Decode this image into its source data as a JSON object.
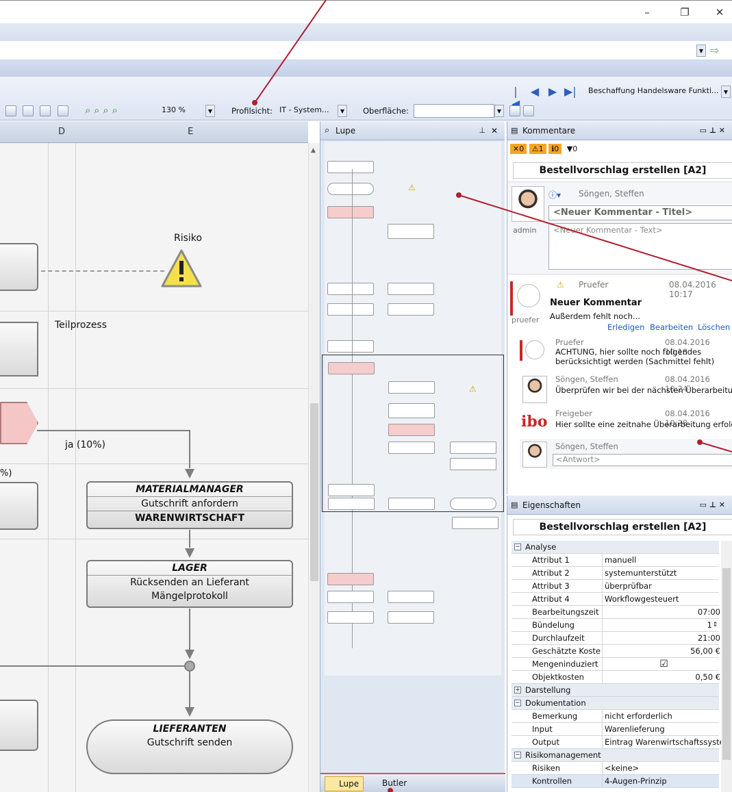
{
  "window": {
    "minimize": "–",
    "restore": "❐",
    "close": "✕"
  },
  "toolbar": {
    "zoom": "130 %",
    "profil_label": "Profilsicht:",
    "profil_value": "IT - System...",
    "oberflaeche_label": "Oberfläche:",
    "oberflaeche_value": "",
    "process_value": "Beschaffung Handelsware Funkti..."
  },
  "diagram": {
    "columns": [
      "D",
      "E"
    ],
    "risk_label": "Risiko",
    "teilprozess": "Teilprozess",
    "branch_yes": "ja (10%)",
    "branch_left": "%)",
    "box1": {
      "role": "MATERIALMANAGER",
      "action": "Gutschrift anfordern",
      "system": "WARENWIRTSCHAFT"
    },
    "box2": {
      "role": "LAGER",
      "action": "Rücksenden an Lieferant",
      "doc": "Mängelprotokoll"
    },
    "box3": {
      "role": "LIEFERANTEN",
      "action": "Gutschrift senden"
    }
  },
  "lupe": {
    "title": "Lupe",
    "tab_lupe": "Lupe",
    "tab_butler": "Butler"
  },
  "kommentare": {
    "title": "Kommentare",
    "counts": {
      "errors": "0",
      "warnings": "1",
      "infos": "0",
      "filter": "0"
    },
    "object": "Bestellvorschlag erstellen [A2]",
    "new": {
      "author": "Söngen, Steffen",
      "title_placeholder": "<Neuer Kommentar - Titel>",
      "text_placeholder": "<Neuer Kommentar - Text>",
      "user": "admin"
    },
    "thread": {
      "author": "Pruefer",
      "date": "08.04.2016 10:17",
      "title": "Neuer Kommentar",
      "text": "Außerdem fehlt noch...",
      "user": "pruefer",
      "actions": [
        "Erledigen",
        "Bearbeiten",
        "Löschen"
      ]
    },
    "replies": [
      {
        "author": "Pruefer",
        "date": "08.04.2016 10:18",
        "text": "ACHTUNG, hier sollte noch folgendes berücksichtigt werden (Sachmittel fehlt)"
      },
      {
        "author": "Söngen, Steffen",
        "date": "08.04.2016 10:24",
        "text": "Überprüfen wir bei der nächsten Überarbeitun"
      },
      {
        "author": "Freigeber",
        "date": "08.04.2016 10:28",
        "text": "Hier sollte eine zeitnahe Überarbeitung erfolg"
      }
    ],
    "reply": {
      "author": "Söngen, Steffen",
      "placeholder": "<Antwort>"
    },
    "ibo": "ibo"
  },
  "eigenschaften": {
    "title": "Eigenschaften",
    "object": "Bestellvorschlag erstellen [A2]",
    "sections": {
      "analyse": "Analyse",
      "darstellung": "Darstellung",
      "dokumentation": "Dokumentation",
      "risiko": "Risikomanagement"
    },
    "analyse": [
      {
        "k": "Attribut 1",
        "v": "manuell"
      },
      {
        "k": "Attribut 2",
        "v": "systemunterstützt"
      },
      {
        "k": "Attribut 3",
        "v": "überprüfbar"
      },
      {
        "k": "Attribut 4",
        "v": "Workflowgesteuert"
      },
      {
        "k": "Bearbeitungszeit",
        "v": "07:00"
      },
      {
        "k": "Bündelung",
        "v": "1"
      },
      {
        "k": "Durchlaufzeit",
        "v": "21:00"
      },
      {
        "k": "Geschätzte Koste",
        "v": "56,00 €"
      },
      {
        "k": "Mengeninduziert",
        "v": "☑"
      },
      {
        "k": "Objektkosten",
        "v": "0,50 €"
      }
    ],
    "doku": [
      {
        "k": "Bemerkung",
        "v": "nicht erforderlich"
      },
      {
        "k": "Input",
        "v": "Warenlieferung"
      },
      {
        "k": "Output",
        "v": "Eintrag Warenwirtschaftssystem"
      }
    ],
    "risiko": [
      {
        "k": "Risiken",
        "v": "<keine>"
      },
      {
        "k": "Kontrollen",
        "v": "4-Augen-Prinzip"
      }
    ]
  }
}
